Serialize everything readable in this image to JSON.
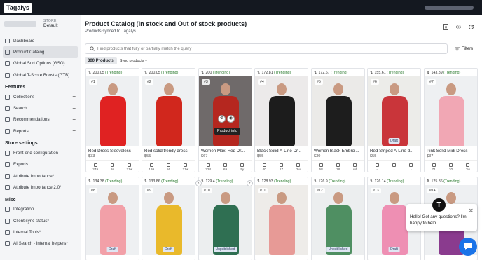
{
  "app": {
    "logo": "Tagalys"
  },
  "store": {
    "label": "STORE",
    "value": "Default"
  },
  "sidebar": {
    "top_items": [
      {
        "label": "Dashboard",
        "active": false
      },
      {
        "label": "Product Catalog",
        "active": true
      },
      {
        "label": "Global Sort Options (GSO)",
        "active": false
      },
      {
        "label": "Global T-Score Boosts (GTB)",
        "active": false
      }
    ],
    "features_title": "Features",
    "features": [
      {
        "label": "Collections",
        "expandable": true
      },
      {
        "label": "Search",
        "expandable": true
      },
      {
        "label": "Recommendations",
        "expandable": true
      },
      {
        "label": "Reports",
        "expandable": true
      }
    ],
    "settings_title": "Store settings",
    "settings": [
      {
        "label": "Front-end configuration",
        "expandable": true
      },
      {
        "label": "Exports",
        "expandable": false
      },
      {
        "label": "Attribute Importance*",
        "expandable": false
      },
      {
        "label": "Attribute Importance 2.0*",
        "expandable": false
      }
    ],
    "misc_title": "Misc",
    "misc": [
      {
        "label": "Integration",
        "expandable": false
      },
      {
        "label": "Client sync status*",
        "expandable": false
      },
      {
        "label": "Internal Tools*",
        "expandable": false
      },
      {
        "label": "AI Search - Internal helpers*",
        "expandable": false
      }
    ]
  },
  "header": {
    "title": "Product Catalog (In stock and Out of stock products)",
    "subtitle": "Products synced to Tagalys"
  },
  "search": {
    "placeholder": "Find products that fully or partially match the query",
    "filters_label": "Filters"
  },
  "toolbar": {
    "products_count": "300 Products",
    "sync_label": "Sync products"
  },
  "tooltip": "Product info",
  "products": [
    {
      "score": "200.05",
      "trend": "(Trending)",
      "rank": "#1",
      "name": "Red Dress Sleeveless",
      "price": "$33",
      "stats": [
        "249",
        "86",
        "21w"
      ],
      "badge": "",
      "dress": "#e02222",
      "bg": "#eef0f2"
    },
    {
      "score": "200.05",
      "trend": "(Trending)",
      "rank": "#2",
      "name": "Red solid trendy dress",
      "price": "$55",
      "stats": [
        "199",
        "56",
        "21w"
      ],
      "badge": "",
      "dress": "#d1271d",
      "bg": "#eef0f2"
    },
    {
      "score": "200",
      "trend": "(Trending)",
      "rank": "#3",
      "name": "Women Maxi Red Dr...",
      "price": "$67",
      "stats": [
        "224",
        "69",
        "5y"
      ],
      "badge": "",
      "dress": "#b5271f",
      "bg": "#6f6a6a"
    },
    {
      "score": "172.81",
      "trend": "(Trending)",
      "rank": "#4",
      "name": "Black Solid A-Line Dr...",
      "price": "$55",
      "stats": [
        "40",
        "17",
        "2w"
      ],
      "badge": "",
      "dress": "#1c1c1c",
      "bg": "#eceaea"
    },
    {
      "score": "172.67",
      "trend": "(Trending)",
      "rank": "#5",
      "name": "Women Black Embroi...",
      "price": "$30",
      "stats": [
        "58",
        "18",
        "6d"
      ],
      "badge": "",
      "dress": "#1d1d1d",
      "bg": "#ebeae8"
    },
    {
      "score": "155.61",
      "trend": "(Trending)",
      "rank": "#6",
      "name": "Red Striped A-Line d...",
      "price": "$55",
      "stats": [
        "-",
        "-",
        "-"
      ],
      "badge": "Draft",
      "dress": "#c9353a",
      "bg": "#ecece9"
    },
    {
      "score": "143.89",
      "trend": "(Trending)",
      "rank": "#7",
      "name": "Pink Solid Midi Dress",
      "price": "$37",
      "stats": [
        "71",
        "20",
        "7w"
      ],
      "badge": "",
      "dress": "#f1a7b4",
      "bg": "#eef0f2"
    },
    {
      "score": "134.38",
      "trend": "(Trending)",
      "rank": "#8",
      "name": "",
      "price": "",
      "stats": [],
      "badge": "Draft",
      "dress": "#f2a0a8",
      "bg": "#eef0f2"
    },
    {
      "score": "133.86",
      "trend": "(Trending)",
      "rank": "#9",
      "name": "",
      "price": "",
      "stats": [],
      "badge": "Draft",
      "dress": "#e9b92b",
      "bg": "#eef0f2"
    },
    {
      "score": "129.4",
      "trend": "(Trending)",
      "rank": "#10",
      "name": "",
      "price": "",
      "stats": [],
      "badge": "Unpublished",
      "dress": "#2f6f52",
      "bg": "#eceeef"
    },
    {
      "score": "128.93",
      "trend": "(Trending)",
      "rank": "#11",
      "name": "",
      "price": "",
      "stats": [],
      "badge": "",
      "dress": "#e79a96",
      "bg": "#eeece9"
    },
    {
      "score": "126.9",
      "trend": "(Trending)",
      "rank": "#12",
      "name": "",
      "price": "",
      "stats": [],
      "badge": "Unpublished",
      "dress": "#4f8f62",
      "bg": "#eceeef"
    },
    {
      "score": "126.14",
      "trend": "(Trending)",
      "rank": "#13",
      "name": "",
      "price": "",
      "stats": [],
      "badge": "Draft",
      "dress": "#ee8fb3",
      "bg": "#eef0f2"
    },
    {
      "score": "125.86",
      "trend": "(Trending)",
      "rank": "#14",
      "name": "",
      "price": "",
      "stats": [],
      "badge": "",
      "dress": "#8a3b8e",
      "bg": "#eef0f2"
    }
  ],
  "chat": {
    "message": "Hello! Got any questions? I'm happy to help.",
    "avatar_letter": "T",
    "close_icon": "close-icon",
    "launcher_icon": "chat-icon"
  }
}
